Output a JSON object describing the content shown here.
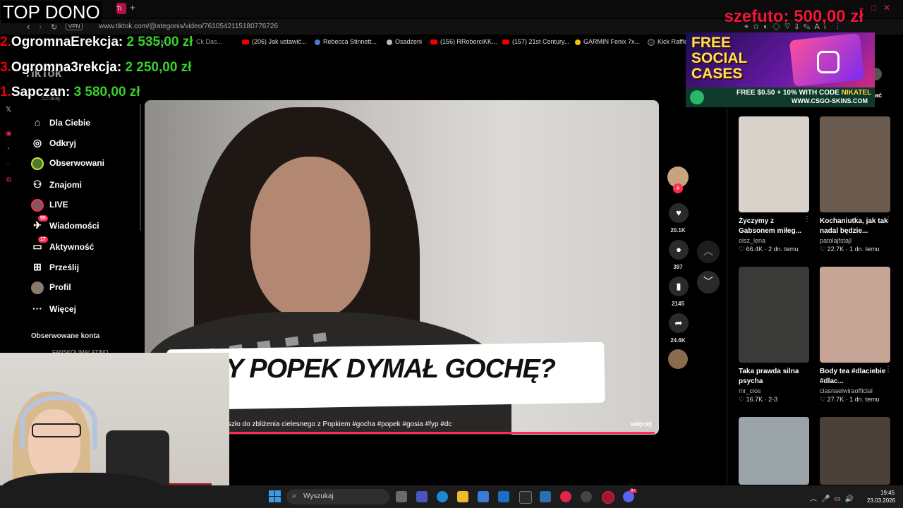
{
  "browser": {
    "tab_label": "Ti",
    "url": "www.tiktok.com/@ategonis/video/7610542115180776726",
    "vpn_label": "VPN",
    "bookmarks": [
      {
        "label": "(206) Jak ustawić...",
        "kind": "youtube"
      },
      {
        "label": "Rebecca Stinnett...",
        "kind": "site"
      },
      {
        "label": "Osadzeni",
        "kind": "site"
      },
      {
        "label": "(156) RRoberciKK...",
        "kind": "youtube"
      },
      {
        "label": "(157) 21st Century...",
        "kind": "youtube"
      },
      {
        "label": "GARMIN Fenix 7x...",
        "kind": "site"
      },
      {
        "label": "Kick Raffle",
        "kind": "site"
      }
    ],
    "partial_bookmarks": [
      "ST Deliv",
      "Ck Das..."
    ],
    "ai_label": "AI"
  },
  "overlay": {
    "top_dono_title": "TOP DONO",
    "donors": [
      {
        "rank": "2.",
        "name": "OgromnaErekcja:",
        "amount": "2 535,00 zł"
      },
      {
        "rank": "3.",
        "name": "Ogromna3rekcja:",
        "amount": "2 250,00 zł"
      },
      {
        "rank": "1.",
        "name": "Sapczan:",
        "amount": "3 580,00 zł"
      }
    ],
    "latest_donor": {
      "name": "szefuto:",
      "amount": "500,00 zł"
    },
    "ad": {
      "title_line1": "FREE",
      "title_line2": "SOCIAL",
      "title_line3": "CASES",
      "code_text": "FREE $0.50 + 10% WITH CODE ",
      "code": "NIKATEL",
      "site": "WWW.CSGO-SKINS.COM"
    }
  },
  "tiktok": {
    "logo": "TikTok",
    "search_placeholder": "Szukaj",
    "nav": [
      {
        "label": "Dla Ciebie",
        "icon": "home-icon",
        "glyph": "⌂"
      },
      {
        "label": "Odkryj",
        "icon": "compass-icon",
        "glyph": "◎"
      },
      {
        "label": "Obserwowani",
        "icon": "following-avatar",
        "glyph": ""
      },
      {
        "label": "Znajomi",
        "icon": "friends-icon",
        "glyph": "⚇"
      },
      {
        "label": "LIVE",
        "icon": "live-avatar",
        "glyph": ""
      },
      {
        "label": "Wiadomości",
        "icon": "messages-icon",
        "glyph": "✈",
        "badge": "55"
      },
      {
        "label": "Aktywność",
        "icon": "activity-icon",
        "glyph": "▭",
        "badge": "17"
      },
      {
        "label": "Prześlij",
        "icon": "upload-icon",
        "glyph": "⊞"
      },
      {
        "label": "Profil",
        "icon": "profile-avatar",
        "glyph": ""
      },
      {
        "label": "Więcej",
        "icon": "more-icon",
        "glyph": "···"
      }
    ],
    "followed_accounts_label": "Obserwowane konta",
    "followed_account_partial": "FANSKOLIMALATINO",
    "video": {
      "caption_overlay": "Y POPEK DYMAŁ GOCHĘ?",
      "description": "szło do zbliżenia cielesnego z Popkiem #gocha #popek #gosia #fyp #dc",
      "more_label": "więcej",
      "progress": 0.99
    },
    "actions": {
      "likes": "20.1K",
      "comments": "397",
      "saves": "2145",
      "shares": "24.6K"
    },
    "panel_header_partial": "ać",
    "recommended": [
      {
        "title": "Życzymy z Gabsonem miłeg...",
        "author": "olsz_lena",
        "views": "66.4K",
        "age": "2 dn. temu",
        "thumb_color": "#d8d2cb"
      },
      {
        "title": "Kochaniutka, jak tak nadal będzie...",
        "author": "patolajfstajl",
        "views": "22.7K",
        "age": "1 dn. temu",
        "thumb_color": "#6b5a4e"
      },
      {
        "title": "Taka prawda silna psycha",
        "author": "mr_cios",
        "views": "16.7K",
        "age": "2-3",
        "thumb_color": "#3a3a38"
      },
      {
        "title": "Body tea #dlaciebie #dlac...",
        "author": "ciasnaelwiraofficial",
        "views": "27.7K",
        "age": "1 dn. temu",
        "thumb_color": "#c7a596"
      },
      {
        "title": "",
        "author": "",
        "views": "",
        "age": "",
        "thumb_color": "#9aa3a8"
      },
      {
        "title": "",
        "author": "",
        "views": "",
        "age": "",
        "thumb_color": "#4a4038"
      }
    ]
  },
  "taskbar": {
    "search_placeholder": "Wyszukaj",
    "time": "19:45",
    "date": "23.03.2026",
    "notification_badge": "9+"
  }
}
